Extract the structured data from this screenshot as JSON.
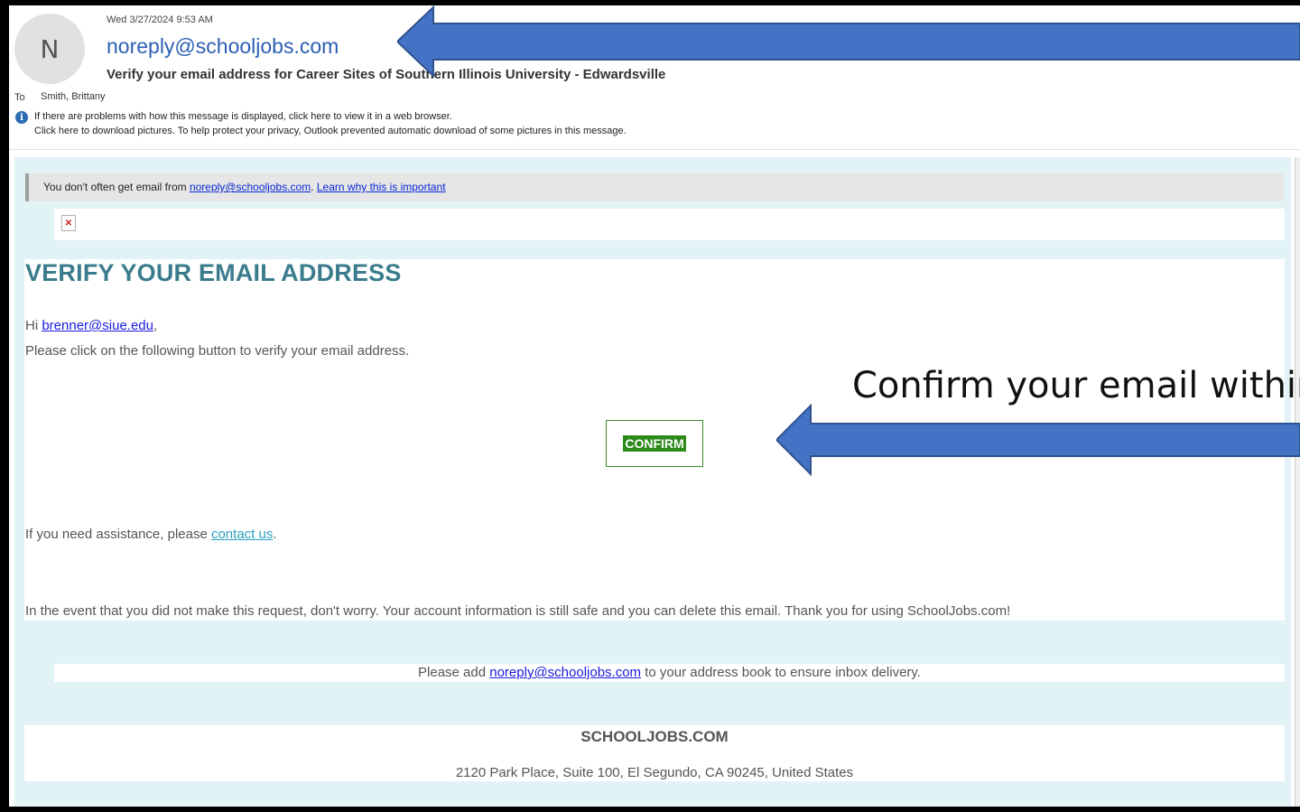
{
  "header": {
    "avatar_initial": "N",
    "date": "Wed 3/27/2024 9:53 AM",
    "from": "noreply@schooljobs.com",
    "subject": "Verify your email address for Career Sites of Southern Illinois University - Edwardsville",
    "to_label": "To",
    "to_value": "Smith, Brittany",
    "info_icon": "info-icon",
    "info_line1": "If there are problems with how this message is displayed, click here to view it in a web browser.",
    "info_line2": "Click here to download pictures. To help protect your privacy, Outlook prevented automatic download of some pictures in this message."
  },
  "banner": {
    "prefix": "You don't often get email from ",
    "email": "noreply@schooljobs.com",
    "dot": ". ",
    "link": "Learn why this is important"
  },
  "email": {
    "title": "VERIFY YOUR EMAIL ADDRESS",
    "greeting": "Hi ",
    "greeting_email": "brenner@siue.edu",
    "greeting_end": ",",
    "instruction": "Please click on the following button to verify your email address.",
    "confirm_label": "CONFIRM",
    "assist_prefix": "If you need assistance, please ",
    "assist_link": "contact us",
    "assist_end": ".",
    "event_text": "In the event that you did not make this request, don't worry. Your account information is still safe and you can delete this email. Thank you for using SchoolJobs.com!",
    "add_prefix": "Please add ",
    "add_email": "noreply@schooljobs.com",
    "add_suffix": " to your address book to ensure inbox delivery.",
    "footer_brand": "SCHOOLJOBS.COM",
    "footer_address": "2120 Park Place, Suite 100, El Segundo, CA 90245, United States"
  },
  "annotation": {
    "callout_text": "Confirm your email within",
    "arrow_color": "#4472c4",
    "arrow_border": "#2f528f"
  }
}
